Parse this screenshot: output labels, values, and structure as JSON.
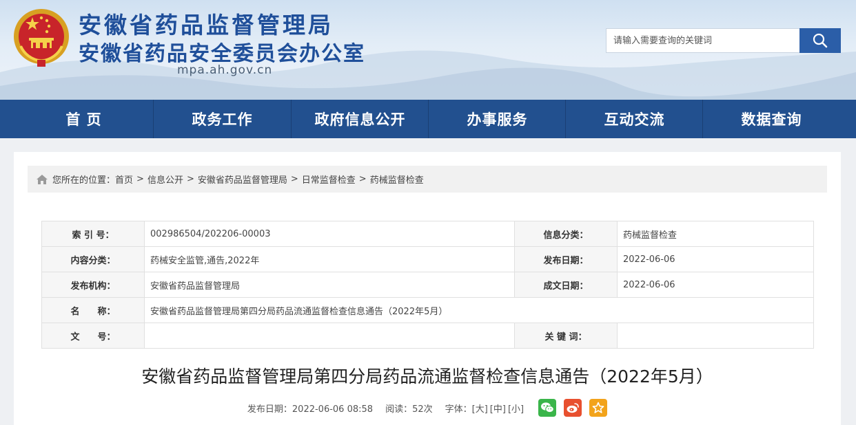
{
  "header": {
    "title_line1": "安徽省药品监督管理局",
    "title_line2": "安徽省药品安全委员会办公室",
    "domain": "mpa.ah.gov.cn",
    "emblem_icon": "national-emblem-icon"
  },
  "search": {
    "placeholder": "请输入需要查询的关键词",
    "button_icon": "search-icon"
  },
  "nav": {
    "items": [
      {
        "label": "首 页"
      },
      {
        "label": "政务工作"
      },
      {
        "label": "政府信息公开"
      },
      {
        "label": "办事服务"
      },
      {
        "label": "互动交流"
      },
      {
        "label": "数据查询"
      }
    ]
  },
  "breadcrumb": {
    "prefix": "您所在的位置：",
    "separator": ">",
    "items": [
      "首页",
      "信息公开",
      "安徽省药品监督管理局",
      "日常监督检查",
      "药械监督检查"
    ]
  },
  "info_table": {
    "index_label": "索 引 号：",
    "index_value": "002986504/202206-00003",
    "info_category_label": "信息分类：",
    "info_category_value": "药械监督检查",
    "content_category_label": "内容分类：",
    "content_category_value": "药械安全监管,通告,2022年",
    "publish_date_label": "发布日期：",
    "publish_date_value": "2022-06-06",
    "publisher_label": "发布机构：",
    "publisher_value": "安徽省药品监督管理局",
    "created_date_label": "成文日期：",
    "created_date_value": "2022-06-06",
    "name_label": "名　　称：",
    "name_value": "安徽省药品监督管理局第四分局药品流通监督检查信息通告（2022年5月）",
    "doc_no_label": "文　　号：",
    "doc_no_value": "",
    "keywords_label": "关 键 词：",
    "keywords_value": ""
  },
  "article": {
    "title": "安徽省药品监督管理局第四分局药品流通监督检查信息通告（2022年5月）",
    "publish_text": "发布日期：2022-06-06 08:58",
    "read_text": "阅读：52次",
    "font_label": "字体：",
    "font_large": "[大]",
    "font_medium": "[中]",
    "font_small": "[小]"
  },
  "share": {
    "wechat": {
      "icon": "wechat-icon",
      "color": "#3ab54a"
    },
    "weibo": {
      "icon": "weibo-icon",
      "color": "#e8502f"
    },
    "favorite": {
      "icon": "star-icon",
      "color": "#f2a31b"
    }
  },
  "colors": {
    "brand": "#1f4f9a",
    "nav_bg": "#22508f",
    "search_button": "#2b5ea8"
  }
}
